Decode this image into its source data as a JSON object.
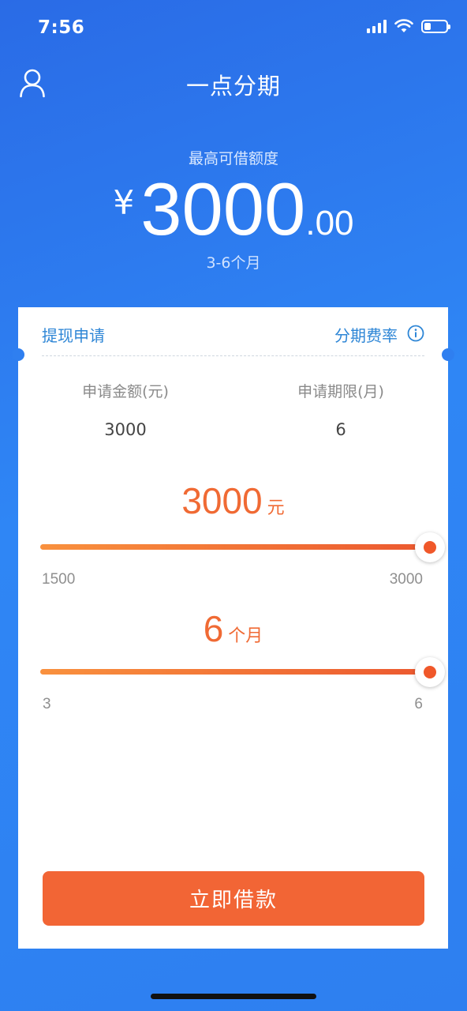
{
  "status_bar": {
    "time": "7:56",
    "battery_level": 0.3
  },
  "header": {
    "title": "一点分期",
    "user_icon": "user-icon"
  },
  "hero": {
    "label": "最高可借额度",
    "currency": "¥",
    "amount_int": "3000",
    "amount_dec": ".00",
    "term": "3-6个月"
  },
  "card": {
    "tab_withdraw": "提现申请",
    "tab_rate": "分期费率",
    "info_icon": "info-circle-icon",
    "amount_col": {
      "label": "申请金额(元)",
      "value": "3000"
    },
    "term_col": {
      "label": "申请期限(月)",
      "value": "6"
    },
    "amount_slider": {
      "value": "3000",
      "unit": "元",
      "min": "1500",
      "max": "3000",
      "fraction": 1.0
    },
    "term_slider": {
      "value": "6",
      "unit": "个月",
      "min": "3",
      "max": "6",
      "fraction": 1.0
    },
    "cta_label": "立即借款"
  },
  "colors": {
    "accent": "#f26535",
    "primary_blue": "#2f7ff0",
    "link_blue": "#2e86d6"
  }
}
